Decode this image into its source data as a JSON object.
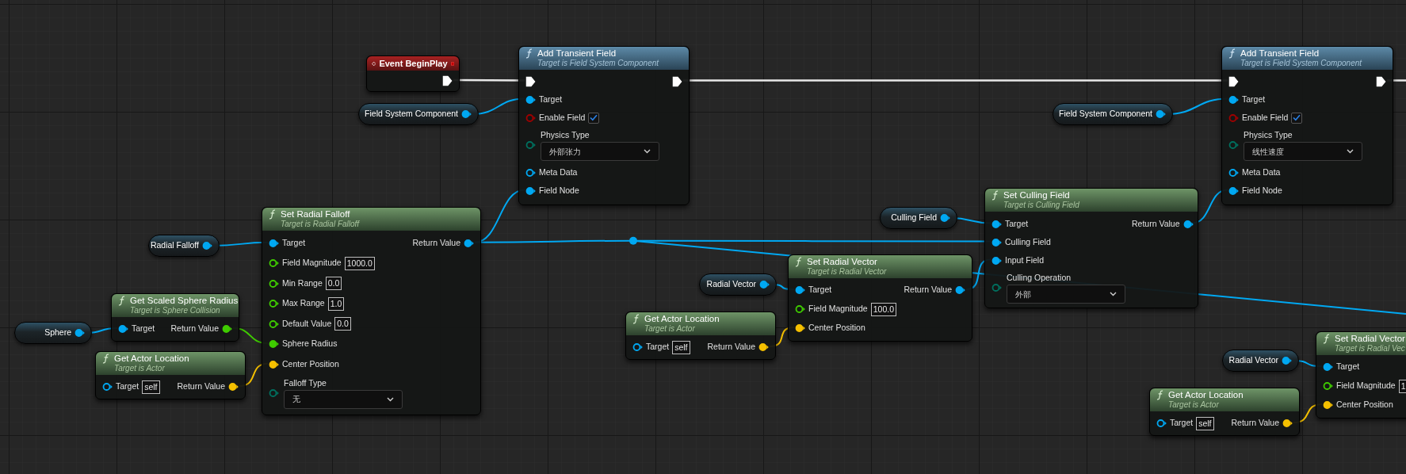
{
  "nodes": [
    {
      "kind": "event",
      "title": "Event BeginPlay",
      "outputs": [
        {
          "kind": "exec",
          "connected": true
        }
      ]
    },
    {
      "kind": "variable",
      "label": "Field System Component",
      "pin": {
        "kind": "object",
        "connected": true
      }
    },
    {
      "kind": "call",
      "title": "Add Transient Field",
      "subtitle": "Target is Field System Component",
      "inputs": [
        {
          "kind": "exec",
          "connected": true
        },
        {
          "kind": "object",
          "label": "Target",
          "connected": true
        },
        {
          "kind": "bool",
          "label": "Enable Field",
          "connected": false,
          "checked": true
        },
        {
          "kind": "enum",
          "label": "Physics Type",
          "connected": false,
          "value": "外部张力"
        },
        {
          "kind": "object",
          "label": "Meta Data",
          "connected": false
        },
        {
          "kind": "object",
          "label": "Field Node",
          "connected": true
        }
      ],
      "outputs": [
        {
          "kind": "exec",
          "connected": true
        }
      ]
    },
    {
      "kind": "variable",
      "label": "Field System Component",
      "pin": {
        "kind": "object",
        "connected": true
      }
    },
    {
      "kind": "call",
      "title": "Add Transient Field",
      "subtitle": "Target is Field System Component",
      "inputs": [
        {
          "kind": "exec",
          "connected": true
        },
        {
          "kind": "object",
          "label": "Target",
          "connected": true
        },
        {
          "kind": "bool",
          "label": "Enable Field",
          "connected": false,
          "checked": true
        },
        {
          "kind": "enum",
          "label": "Physics Type",
          "connected": false,
          "value": "线性速度"
        },
        {
          "kind": "object",
          "label": "Meta Data",
          "connected": false
        },
        {
          "kind": "object",
          "label": "Field Node",
          "connected": true
        }
      ],
      "outputs": [
        {
          "kind": "exec",
          "connected": true
        }
      ]
    },
    {
      "kind": "variable",
      "label": "Radial Falloff",
      "pin": {
        "kind": "object",
        "connected": true
      }
    },
    {
      "kind": "pure",
      "title": "Set Radial Falloff",
      "subtitle": "Target is Radial Falloff",
      "inputs": [
        {
          "kind": "object",
          "label": "Target",
          "connected": true
        },
        {
          "kind": "float",
          "label": "Field Magnitude",
          "connected": false,
          "value": "1000.0"
        },
        {
          "kind": "float",
          "label": "Min Range",
          "connected": false,
          "value": "0.0"
        },
        {
          "kind": "float",
          "label": "Max Range",
          "connected": false,
          "value": "1.0"
        },
        {
          "kind": "float",
          "label": "Default Value",
          "connected": false,
          "value": "0.0"
        },
        {
          "kind": "float",
          "label": "Sphere Radius",
          "connected": true
        },
        {
          "kind": "vector",
          "label": "Center Position",
          "connected": true
        },
        {
          "kind": "enum",
          "label": "Falloff Type",
          "connected": false,
          "value": "无"
        }
      ],
      "outputs": [
        {
          "kind": "object",
          "label": "Return Value",
          "connected": true
        }
      ]
    },
    {
      "kind": "variable",
      "label": "Sphere",
      "pin": {
        "kind": "object",
        "connected": true
      }
    },
    {
      "kind": "pure",
      "title": "Get Scaled Sphere Radius",
      "subtitle": "Target is Sphere Collision",
      "inputs": [
        {
          "kind": "object",
          "label": "Target",
          "connected": true
        }
      ],
      "outputs": [
        {
          "kind": "float",
          "label": "Return Value",
          "connected": true
        }
      ]
    },
    {
      "kind": "pure",
      "title": "Get Actor Location",
      "subtitle": "Target is Actor",
      "inputs": [
        {
          "kind": "object",
          "label": "Target",
          "connected": false,
          "value": "self"
        }
      ],
      "outputs": [
        {
          "kind": "vector",
          "label": "Return Value",
          "connected": true
        }
      ]
    },
    {
      "kind": "variable",
      "label": "Culling Field",
      "pin": {
        "kind": "object",
        "connected": true
      }
    },
    {
      "kind": "pure",
      "title": "Set Culling Field",
      "subtitle": "Target is Culling Field",
      "inputs": [
        {
          "kind": "object",
          "label": "Target",
          "connected": true
        },
        {
          "kind": "object",
          "label": "Culling Field",
          "connected": true
        },
        {
          "kind": "object",
          "label": "Input Field",
          "connected": true
        },
        {
          "kind": "enum",
          "label": "Culling Operation",
          "connected": false,
          "value": "外部"
        }
      ],
      "outputs": [
        {
          "kind": "object",
          "label": "Return Value",
          "connected": true
        }
      ]
    },
    {
      "kind": "variable",
      "label": "Radial Vector",
      "pin": {
        "kind": "object",
        "connected": true
      }
    },
    {
      "kind": "pure",
      "title": "Set Radial Vector",
      "subtitle": "Target is Radial Vector",
      "inputs": [
        {
          "kind": "object",
          "label": "Target",
          "connected": true
        },
        {
          "kind": "float",
          "label": "Field Magnitude",
          "connected": false,
          "value": "100.0"
        },
        {
          "kind": "vector",
          "label": "Center Position",
          "connected": true
        }
      ],
      "outputs": [
        {
          "kind": "object",
          "label": "Return Value",
          "connected": true
        }
      ]
    },
    {
      "kind": "pure",
      "title": "Get Actor Location",
      "subtitle": "Target is Actor",
      "inputs": [
        {
          "kind": "object",
          "label": "Target",
          "connected": false,
          "value": "self"
        }
      ],
      "outputs": [
        {
          "kind": "vector",
          "label": "Return Value",
          "connected": true
        }
      ]
    },
    {
      "kind": "variable",
      "label": "Radial Vector",
      "pin": {
        "kind": "object",
        "connected": true
      }
    },
    {
      "kind": "pure",
      "title": "Set Radial Vector",
      "subtitle": "Target is Radial Vec",
      "inputs": [
        {
          "kind": "object",
          "label": "Target",
          "connected": true
        },
        {
          "kind": "float",
          "label": "Field Magnitude",
          "connected": false,
          "value": "1"
        },
        {
          "kind": "vector",
          "label": "Center Position",
          "connected": true
        }
      ]
    },
    {
      "kind": "pure",
      "title": "Get Actor Location",
      "subtitle": "Target is Actor",
      "inputs": [
        {
          "kind": "object",
          "label": "Target",
          "connected": false,
          "value": "self"
        }
      ],
      "outputs": [
        {
          "kind": "vector",
          "label": "Return Value",
          "connected": true
        }
      ]
    }
  ]
}
